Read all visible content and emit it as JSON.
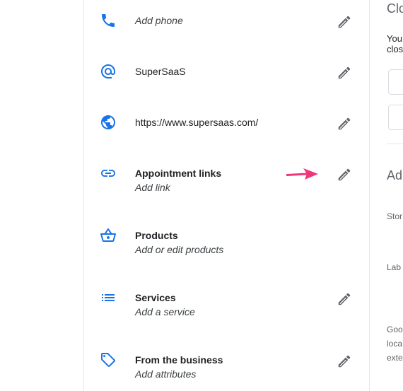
{
  "rows": [
    {
      "name": "phone",
      "icon": "phone-icon",
      "sub": "Add phone"
    },
    {
      "name": "website-name",
      "icon": "at-sign-icon",
      "value": "SuperSaaS"
    },
    {
      "name": "website",
      "icon": "globe-icon",
      "value": "https://www.supersaas.com/"
    },
    {
      "name": "appointment-links",
      "icon": "link-icon",
      "title": "Appointment links",
      "sub": "Add link"
    },
    {
      "name": "products",
      "icon": "basket-icon",
      "title": "Products",
      "sub": "Add or edit products"
    },
    {
      "name": "services",
      "icon": "list-icon",
      "title": "Services",
      "sub": "Add a service"
    },
    {
      "name": "from-the-business",
      "icon": "tag-icon",
      "title": "From the business",
      "sub": "Add attributes"
    }
  ],
  "right_pane": {
    "heading_top": "Clo",
    "text_line1": "You",
    "text_line2": "clos",
    "heading_mid": "Ad",
    "label_store": "Stor",
    "label_labels": "Lab",
    "small_lines": [
      "Goo",
      "loca",
      "exte"
    ]
  },
  "colors": {
    "icon_blue": "#1a73e8",
    "edit_gray": "#5f6368",
    "arrow_pink": "#f0367a"
  }
}
